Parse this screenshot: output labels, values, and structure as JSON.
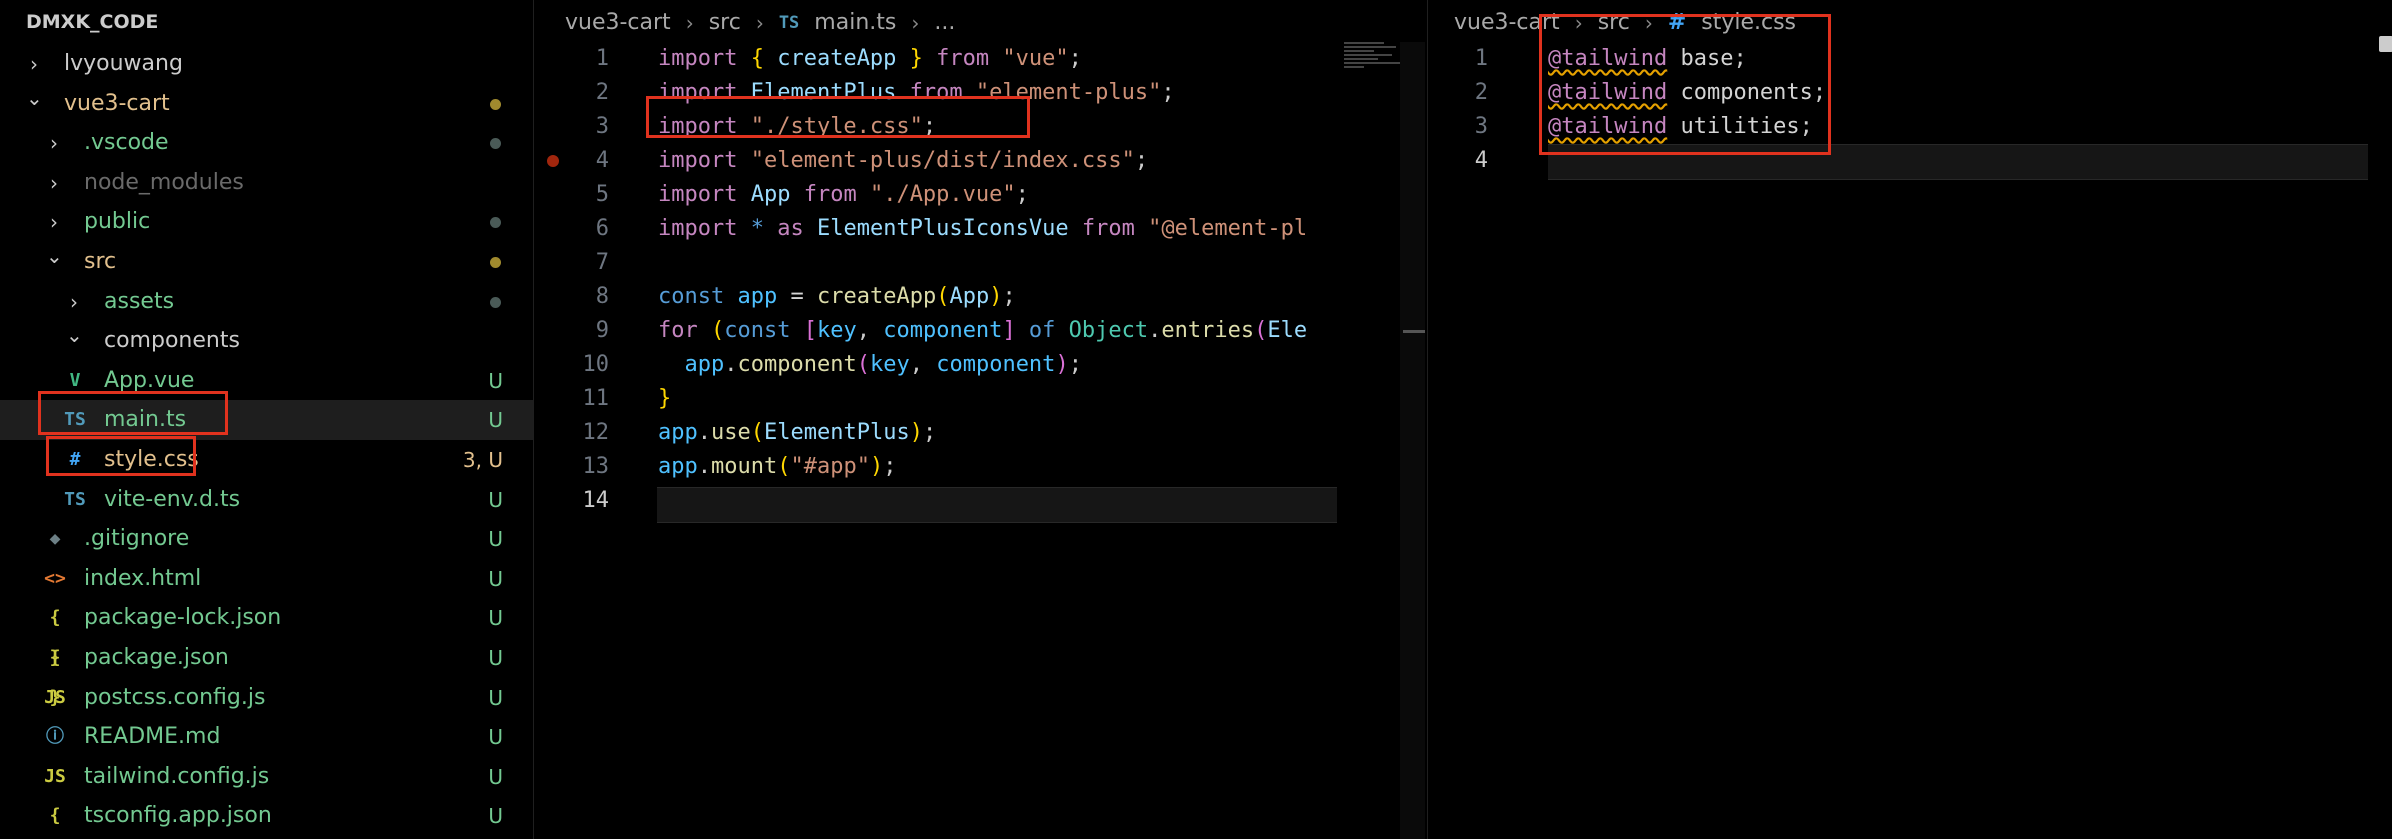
{
  "explorer": {
    "title": "DMXK_CODE",
    "items": [
      {
        "label": "lvyouwang",
        "type": "folder",
        "open": false
      },
      {
        "label": "vue3-cart",
        "type": "folder",
        "open": true,
        "status": "modified-dot"
      },
      {
        "label": ".vscode",
        "type": "folder",
        "open": false,
        "status": "dot"
      },
      {
        "label": "node_modules",
        "type": "folder",
        "open": false
      },
      {
        "label": "public",
        "type": "folder",
        "open": false,
        "status": "dot"
      },
      {
        "label": "src",
        "type": "folder",
        "open": true,
        "status": "modified-dot"
      },
      {
        "label": "assets",
        "type": "folder",
        "open": false,
        "status": "dot"
      },
      {
        "label": "components",
        "type": "folder",
        "open": true
      },
      {
        "label": "App.vue",
        "type": "vue",
        "badge": "U"
      },
      {
        "label": "main.ts",
        "type": "ts",
        "badge": "U",
        "active": true
      },
      {
        "label": "style.css",
        "type": "css",
        "badge": "3, U"
      },
      {
        "label": "vite-env.d.ts",
        "type": "ts",
        "badge": "U"
      },
      {
        "label": ".gitignore",
        "type": "git",
        "badge": "U"
      },
      {
        "label": "index.html",
        "type": "html",
        "badge": "U"
      },
      {
        "label": "package-lock.json",
        "type": "json",
        "badge": "U"
      },
      {
        "label": "package.json",
        "type": "json",
        "badge": "U"
      },
      {
        "label": "postcss.config.js",
        "type": "js",
        "badge": "U"
      },
      {
        "label": "README.md",
        "type": "info",
        "badge": "U"
      },
      {
        "label": "tailwind.config.js",
        "type": "js",
        "badge": "U"
      },
      {
        "label": "tsconfig.app.json",
        "type": "json",
        "badge": "U"
      }
    ],
    "icon_glyphs": {
      "ts": "TS",
      "css": "#",
      "js": "JS",
      "json": "{ }",
      "html": "<>",
      "git": "◆",
      "info": "ⓘ",
      "vue": "V"
    }
  },
  "editor_left": {
    "breadcrumb": {
      "folder": "vue3-cart",
      "sub": "src",
      "file_icon": "TS",
      "file": "main.ts",
      "more": "..."
    },
    "current_line": 14,
    "lines": [
      {
        "n": "1",
        "tokens": [
          [
            "kw",
            "import "
          ],
          [
            "brk1",
            "{ "
          ],
          [
            "id",
            "createApp"
          ],
          [
            "brk1",
            " }"
          ],
          [
            "kw",
            " from "
          ],
          [
            "str",
            "\"vue\""
          ],
          [
            "pun",
            ";"
          ]
        ]
      },
      {
        "n": "2",
        "tokens": [
          [
            "kw",
            "import "
          ],
          [
            "id",
            "ElementPlus"
          ],
          [
            "kw",
            " from "
          ],
          [
            "str",
            "\"element-plus\""
          ],
          [
            "pun",
            ";"
          ]
        ]
      },
      {
        "n": "3",
        "tokens": [
          [
            "kw",
            "import "
          ],
          [
            "str",
            "\"./style.css\""
          ],
          [
            "pun",
            ";"
          ]
        ]
      },
      {
        "n": "4",
        "tokens": [
          [
            "kw",
            "import "
          ],
          [
            "str",
            "\"element-plus/dist/index.css\""
          ],
          [
            "pun",
            ";"
          ]
        ]
      },
      {
        "n": "5",
        "tokens": [
          [
            "kw",
            "import "
          ],
          [
            "id",
            "App"
          ],
          [
            "kw",
            " from "
          ],
          [
            "str",
            "\"./App.vue\""
          ],
          [
            "pun",
            ";"
          ]
        ]
      },
      {
        "n": "6",
        "tokens": [
          [
            "kw",
            "import "
          ],
          [
            "decl",
            "* "
          ],
          [
            "kw",
            "as "
          ],
          [
            "id",
            "ElementPlusIconsVue"
          ],
          [
            "kw",
            " from "
          ],
          [
            "str",
            "\"@element-pl"
          ]
        ]
      },
      {
        "n": "7",
        "tokens": []
      },
      {
        "n": "8",
        "tokens": [
          [
            "decl",
            "const "
          ],
          [
            "var",
            "app"
          ],
          [
            "def",
            " = "
          ],
          [
            "fn",
            "createApp"
          ],
          [
            "brk1",
            "("
          ],
          [
            "id",
            "App"
          ],
          [
            "brk1",
            ")"
          ],
          [
            "pun",
            ";"
          ]
        ]
      },
      {
        "n": "9",
        "tokens": [
          [
            "kw",
            "for "
          ],
          [
            "brk1",
            "("
          ],
          [
            "decl",
            "const "
          ],
          [
            "brk2",
            "["
          ],
          [
            "var",
            "key"
          ],
          [
            "pun",
            ", "
          ],
          [
            "var",
            "component"
          ],
          [
            "brk2",
            "]"
          ],
          [
            "decl",
            " of "
          ],
          [
            "cls",
            "Object"
          ],
          [
            "pun",
            "."
          ],
          [
            "fn",
            "entries"
          ],
          [
            "brk2",
            "("
          ],
          [
            "id",
            "Ele"
          ]
        ]
      },
      {
        "n": "10",
        "tokens": [
          [
            "def",
            "  "
          ],
          [
            "var",
            "app"
          ],
          [
            "pun",
            "."
          ],
          [
            "fn",
            "component"
          ],
          [
            "brk2",
            "("
          ],
          [
            "var",
            "key"
          ],
          [
            "pun",
            ", "
          ],
          [
            "var",
            "component"
          ],
          [
            "brk2",
            ")"
          ],
          [
            "pun",
            ";"
          ]
        ]
      },
      {
        "n": "11",
        "tokens": [
          [
            "brk1",
            "}"
          ]
        ]
      },
      {
        "n": "12",
        "tokens": [
          [
            "var",
            "app"
          ],
          [
            "pun",
            "."
          ],
          [
            "fn",
            "use"
          ],
          [
            "brk1",
            "("
          ],
          [
            "id",
            "ElementPlus"
          ],
          [
            "brk1",
            ")"
          ],
          [
            "pun",
            ";"
          ]
        ]
      },
      {
        "n": "13",
        "tokens": [
          [
            "var",
            "app"
          ],
          [
            "pun",
            "."
          ],
          [
            "fn",
            "mount"
          ],
          [
            "brk1",
            "("
          ],
          [
            "str",
            "\"#app\""
          ],
          [
            "brk1",
            ")"
          ],
          [
            "pun",
            ";"
          ]
        ]
      },
      {
        "n": "14",
        "tokens": []
      }
    ]
  },
  "editor_right": {
    "breadcrumb": {
      "folder": "vue3-cart",
      "sub": "src",
      "file_icon": "#",
      "file": "style.css"
    },
    "current_line": 4,
    "lines": [
      {
        "n": "1",
        "tokens": [
          [
            "at",
            "@tailwind"
          ],
          [
            "def",
            " base"
          ],
          [
            "pun",
            ";"
          ]
        ]
      },
      {
        "n": "2",
        "tokens": [
          [
            "at",
            "@tailwind"
          ],
          [
            "def",
            " components"
          ],
          [
            "pun",
            ";"
          ]
        ]
      },
      {
        "n": "3",
        "tokens": [
          [
            "at",
            "@tailwind"
          ],
          [
            "def",
            " utilities"
          ],
          [
            "pun",
            ";"
          ]
        ]
      },
      {
        "n": "4",
        "tokens": []
      }
    ]
  },
  "colors": {
    "background": "#000000",
    "highlight_box": "#e0321e",
    "untracked": "#73c991",
    "modified": "#e2c08d",
    "error": "#e57373"
  }
}
